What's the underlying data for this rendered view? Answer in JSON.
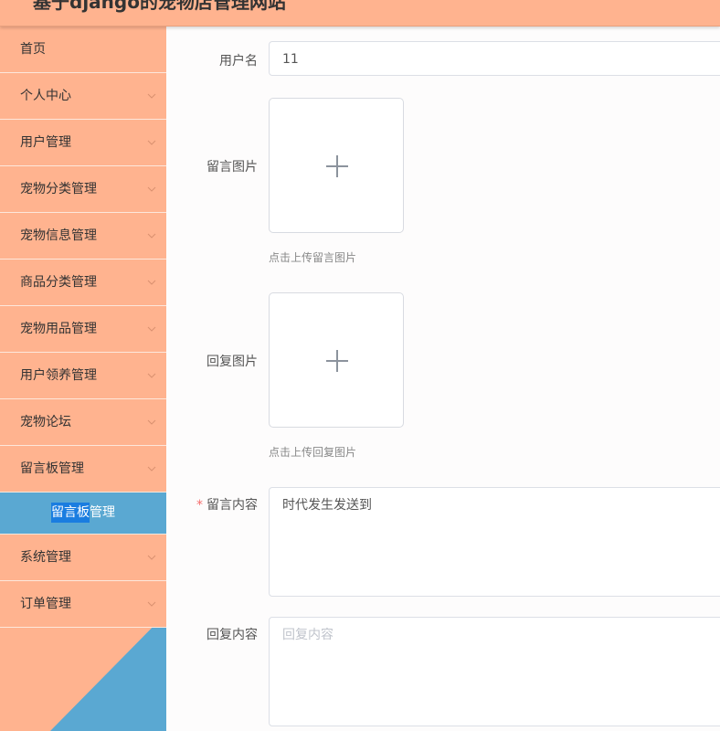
{
  "header": {
    "title": "基于django的宠物店管理网站"
  },
  "sidebar": {
    "items": [
      {
        "label": "首页",
        "has_arrow": false
      },
      {
        "label": "个人中心",
        "has_arrow": true
      },
      {
        "label": "用户管理",
        "has_arrow": true
      },
      {
        "label": "宠物分类管理",
        "has_arrow": true
      },
      {
        "label": "宠物信息管理",
        "has_arrow": true
      },
      {
        "label": "商品分类管理",
        "has_arrow": true
      },
      {
        "label": "宠物用品管理",
        "has_arrow": true
      },
      {
        "label": "用户领养管理",
        "has_arrow": true
      },
      {
        "label": "宠物论坛",
        "has_arrow": true
      },
      {
        "label": "留言板管理",
        "has_arrow": true
      },
      {
        "label": "系统管理",
        "has_arrow": true
      },
      {
        "label": "订单管理",
        "has_arrow": true
      }
    ],
    "active_sub": {
      "highlight": "留言板",
      "rest": "管理"
    },
    "colors": {
      "bg": "#ffb38f",
      "active": "#5aa8d2",
      "triangle": "#5aa8d2"
    }
  },
  "form": {
    "username_label": "用户名",
    "username_value": "11",
    "message_image_label": "留言图片",
    "message_image_hint": "点击上传留言图片",
    "reply_image_label": "回复图片",
    "reply_image_hint": "点击上传回复图片",
    "message_content_label": "留言内容",
    "required_mark": "*",
    "message_content_value": "时代发生发送到",
    "reply_content_label": "回复内容",
    "reply_content_placeholder": "回复内容"
  },
  "icons": {
    "upload": "plus-icon",
    "menu_arrow": "chevron-down-icon"
  }
}
